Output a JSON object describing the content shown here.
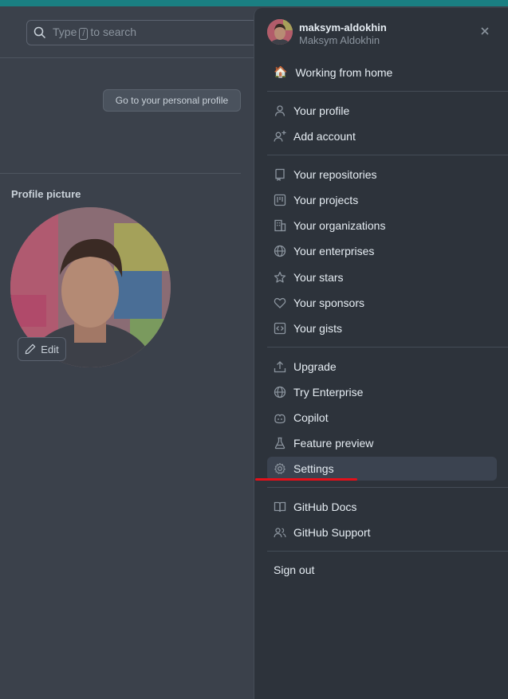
{
  "search": {
    "prefix": "Type",
    "key": "/",
    "suffix": "to search"
  },
  "profile": {
    "go_button": "Go to your personal profile",
    "picture_label": "Profile picture",
    "edit_label": "Edit"
  },
  "menu": {
    "login": "maksym-aldokhin",
    "full_name": "Maksym Aldokhin",
    "status_emoji": "🏠",
    "status_text": "Working from home",
    "items": [
      {
        "label": "Your profile",
        "icon": "person-icon"
      },
      {
        "label": "Add account",
        "icon": "person-add-icon"
      },
      {
        "label": "Your repositories",
        "icon": "repo-icon"
      },
      {
        "label": "Your projects",
        "icon": "project-icon"
      },
      {
        "label": "Your organizations",
        "icon": "organization-icon"
      },
      {
        "label": "Your enterprises",
        "icon": "globe-icon"
      },
      {
        "label": "Your stars",
        "icon": "star-icon"
      },
      {
        "label": "Your sponsors",
        "icon": "heart-icon"
      },
      {
        "label": "Your gists",
        "icon": "code-square-icon"
      },
      {
        "label": "Upgrade",
        "icon": "upload-icon"
      },
      {
        "label": "Try Enterprise",
        "icon": "globe-icon"
      },
      {
        "label": "Copilot",
        "icon": "copilot-icon"
      },
      {
        "label": "Feature preview",
        "icon": "beaker-icon"
      },
      {
        "label": "Settings",
        "icon": "gear-icon"
      },
      {
        "label": "GitHub Docs",
        "icon": "book-icon"
      },
      {
        "label": "GitHub Support",
        "icon": "people-icon"
      }
    ],
    "sign_out": "Sign out",
    "active_item": "Settings"
  },
  "colors": {
    "accent_bar": "#1a7f82",
    "annotation": "#e4101a"
  }
}
